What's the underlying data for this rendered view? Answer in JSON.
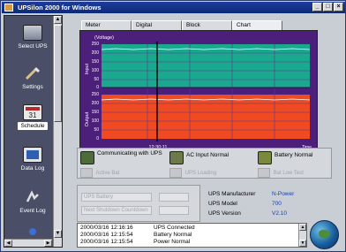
{
  "window": {
    "title": "UPSilon 2000 for Windows"
  },
  "sidebar": {
    "items": [
      {
        "label": "Select UPS",
        "icon": "ups-icon"
      },
      {
        "label": "Settings",
        "icon": "tools-icon"
      },
      {
        "label": "Schedule",
        "icon": "calendar-icon",
        "active": true
      },
      {
        "label": "Data Log",
        "icon": "data-log-icon"
      },
      {
        "label": "Event Log",
        "icon": "event-log-icon"
      }
    ]
  },
  "tabs": [
    {
      "label": "Meter"
    },
    {
      "label": "Digital"
    },
    {
      "label": "Block"
    },
    {
      "label": "Chart",
      "active": true
    }
  ],
  "chart": {
    "unit_label": "(Voltage)",
    "input_label": "Input",
    "output_label": "Output",
    "time_label": "12:30:11",
    "axis_end_label": "Time",
    "yticks": [
      "250",
      "200",
      "150",
      "100",
      "50",
      "0"
    ],
    "colors": {
      "background": "#4b1f7a",
      "input": "#1aa88e",
      "output": "#f04a22"
    }
  },
  "status": {
    "communication": "Communicating with UPS",
    "ac_input": "AC Input Normal",
    "battery": "Battery Normal",
    "ghost_labels": [
      "Active Bat",
      "UPS Loading",
      "Bat Low Test"
    ]
  },
  "lower_left": {
    "ghost_labels": [
      "UPS Battery",
      "Next Shutdown Countdown"
    ]
  },
  "ups_info": {
    "manufacturer_label": "UPS Manufacturer",
    "manufacturer": "N-Power",
    "model_label": "UPS Model",
    "model": "700",
    "version_label": "UPS Version",
    "version": "V2.10"
  },
  "event_log": [
    {
      "time": "2000/03/16 12:16:16",
      "message": "UPS Connected"
    },
    {
      "time": "2000/03/16 12:15:54",
      "message": "Battery Normal"
    },
    {
      "time": "2000/03/16 12:15:54",
      "message": "Power Normal"
    }
  ]
}
